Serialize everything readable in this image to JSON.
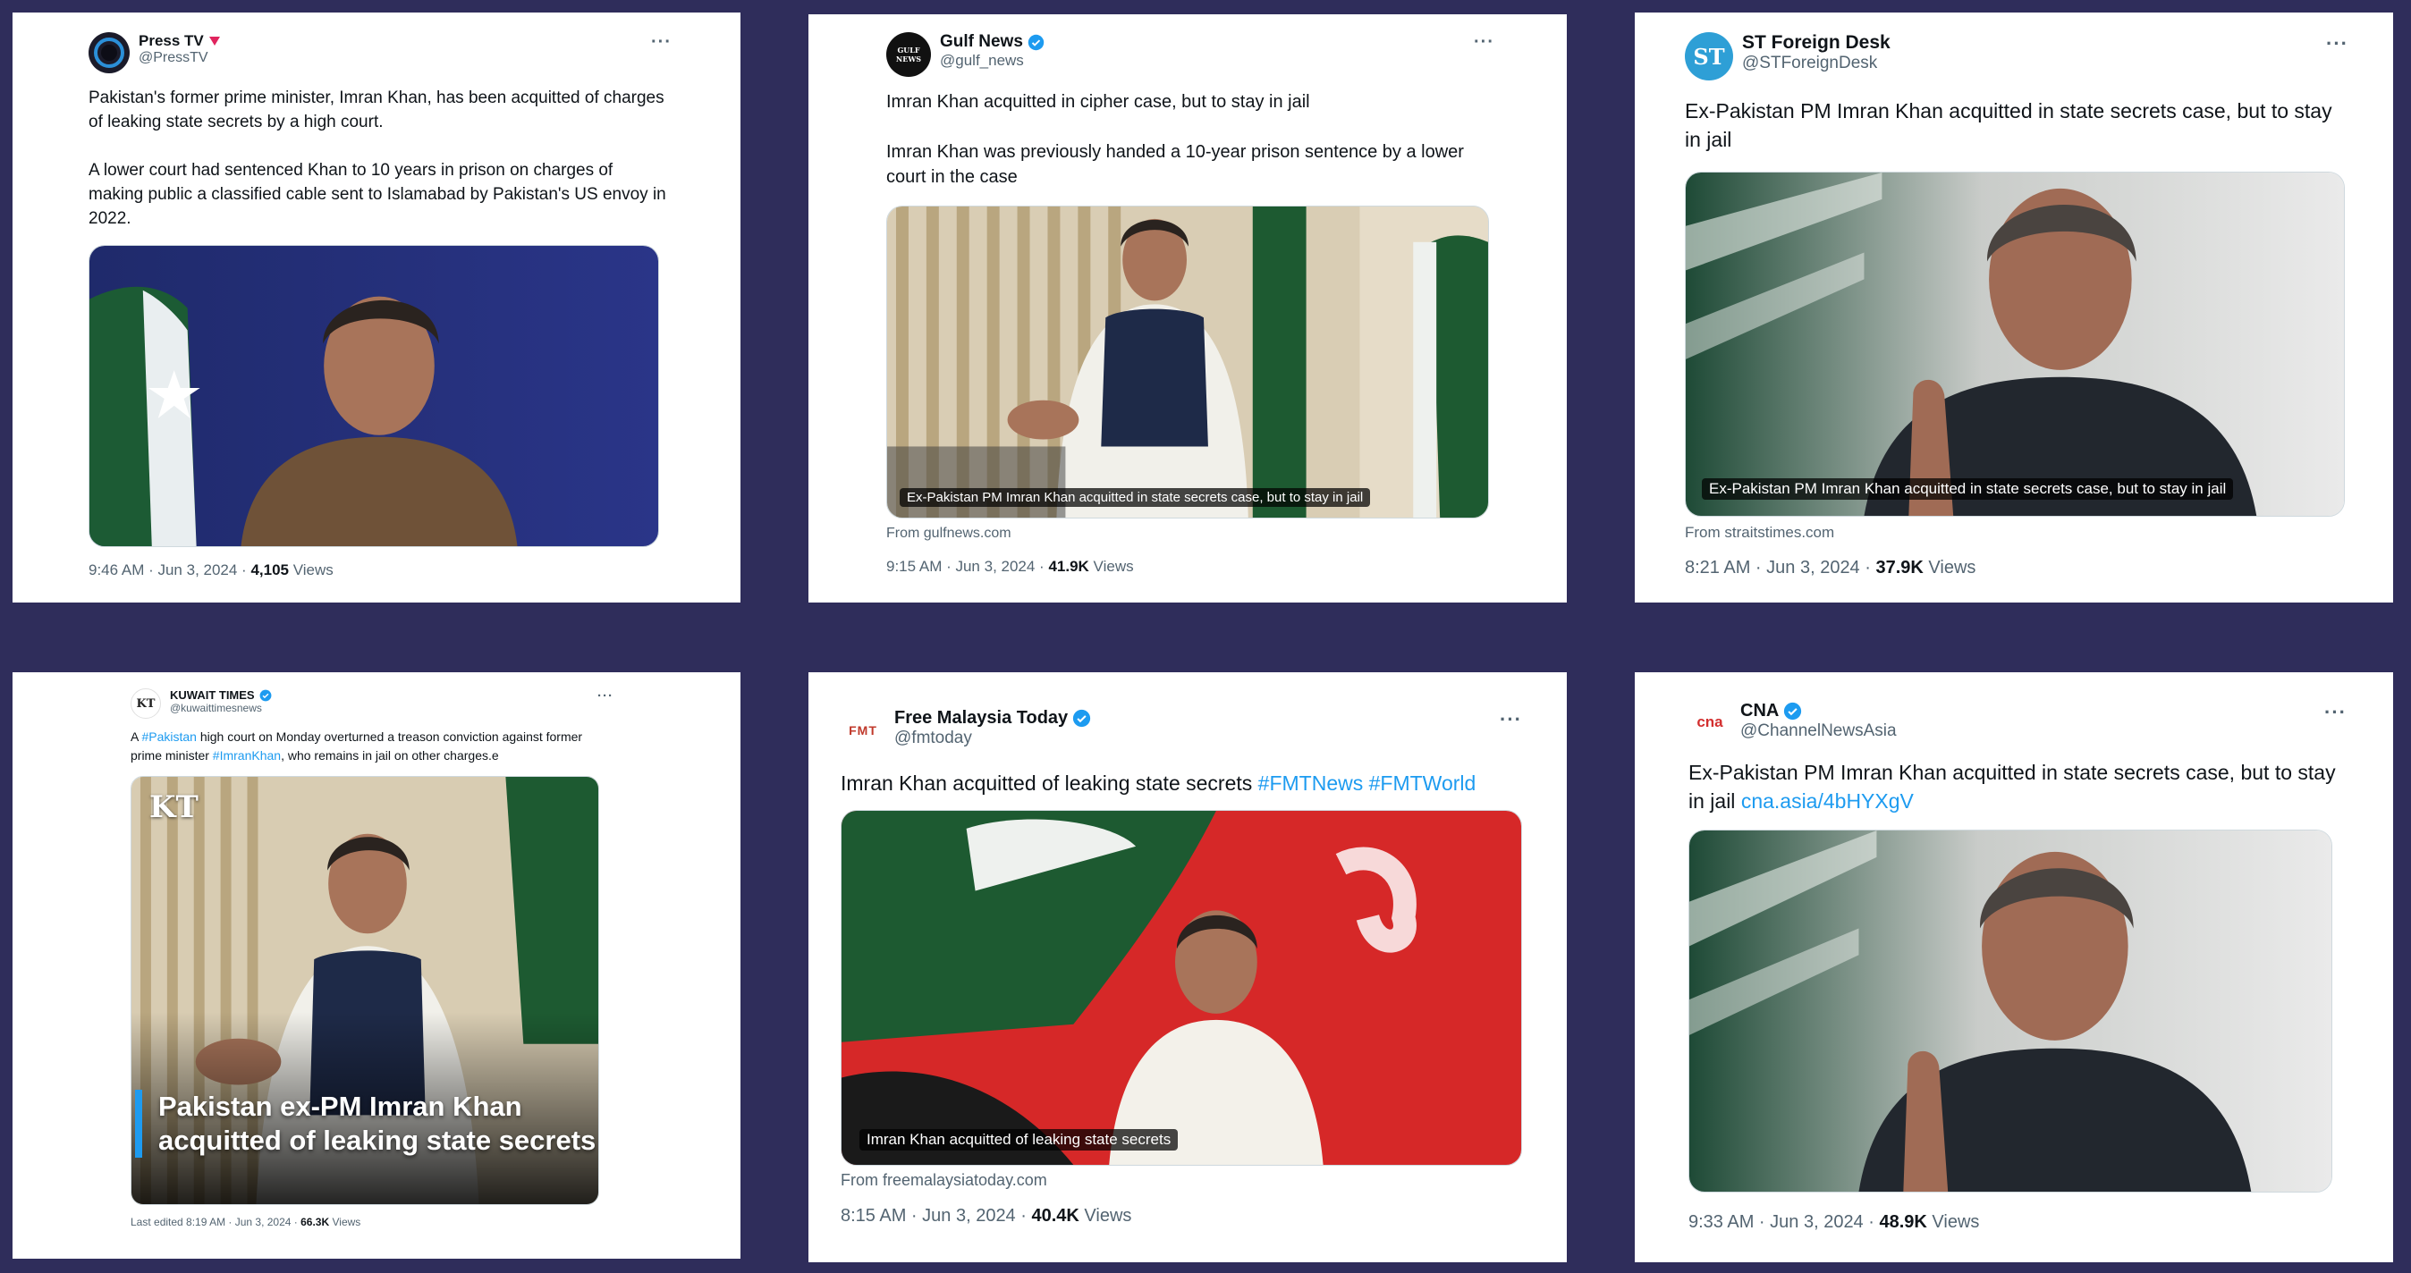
{
  "colors": {
    "background": "#2f2d5b",
    "card": "#ffffff",
    "link": "#1d9bf0",
    "verified": "#1d9bf0",
    "muted": "#536471"
  },
  "tweets": [
    {
      "account_name": "Press TV",
      "handle": "@PressTV",
      "badge_icon": "red-triangle-icon",
      "more": "···",
      "text_p1": "Pakistan's former prime minister, Imran Khan, has been acquitted of charges of leaking state secrets by a high court.",
      "text_p2": "A lower court had sentenced Khan to 10 years in prison on charges of making public a classified cable sent to Islamabad by Pakistan's US envoy in 2022.",
      "time": "9:46 AM · Jun 3, 2024 · ",
      "views_count": "4,105",
      "views_label": " Views"
    },
    {
      "account_name": "Gulf News",
      "handle": "@gulf_news",
      "avatar_text": "GULF NEWS",
      "badge_icon": "verified-icon",
      "more": "···",
      "text_p1": "Imran Khan acquitted in cipher case, but to stay in jail",
      "text_p2": "Imran Khan was previously handed a 10-year prison sentence by a lower court in the case",
      "image_caption": "Ex-Pakistan PM Imran Khan acquitted in state secrets case, but to stay in jail",
      "from": "From gulfnews.com",
      "time": "9:15 AM · Jun 3, 2024 · ",
      "views_count": "41.9K",
      "views_label": " Views"
    },
    {
      "account_name": "ST Foreign Desk",
      "handle": "@STForeignDesk",
      "avatar_text": "ST",
      "badge_icon": "none",
      "more": "···",
      "text_p1": "Ex-Pakistan PM Imran Khan acquitted in state secrets case, but to stay in jail",
      "image_caption": "Ex-Pakistan PM Imran Khan acquitted in state secrets case, but to stay in jail",
      "from": "From straitstimes.com",
      "time": "8:21 AM · Jun 3, 2024 · ",
      "views_count": "37.9K",
      "views_label": " Views"
    },
    {
      "account_name": "KUWAIT TIMES",
      "handle": "@kuwaittimesnews",
      "avatar_text": "KT",
      "badge_icon": "verified-icon",
      "more": "···",
      "text_a": "A ",
      "text_link1": "#Pakistan",
      "text_b": " high court on Monday overturned a treason conviction against former prime minister ",
      "text_link2": "#ImranKhan",
      "text_c": ", who remains in jail on other charges.e",
      "image_logo": "KT",
      "image_headline": "Pakistan ex-PM Imran Khan acquitted of leaking state secrets",
      "time": "Last edited 8:19 AM · Jun 3, 2024 · ",
      "views_count": "66.3K",
      "views_label": " Views"
    },
    {
      "account_name": "Free Malaysia Today",
      "handle": "@fmtoday",
      "avatar_text": "FMT",
      "badge_icon": "verified-icon",
      "more": "···",
      "text_a": "Imran Khan acquitted of leaking state secrets  ",
      "text_link1": "#FMTNews",
      "text_sep": " ",
      "text_link2": "#FMTWorld",
      "image_caption": "Imran Khan acquitted of leaking state secrets",
      "from": "From freemalaysiatoday.com",
      "time": "8:15 AM · Jun 3, 2024 · ",
      "views_count": "40.4K",
      "views_label": " Views"
    },
    {
      "account_name": "CNA",
      "handle": "@ChannelNewsAsia",
      "avatar_text": "cna",
      "badge_icon": "verified-icon",
      "more": "···",
      "text_a": "Ex-Pakistan PM Imran Khan acquitted in state secrets case, but to stay in jail ",
      "text_link1": "cna.asia/4bHYXgV",
      "time": "9:33 AM · Jun 3, 2024 · ",
      "views_count": "48.9K",
      "views_label": " Views"
    }
  ]
}
